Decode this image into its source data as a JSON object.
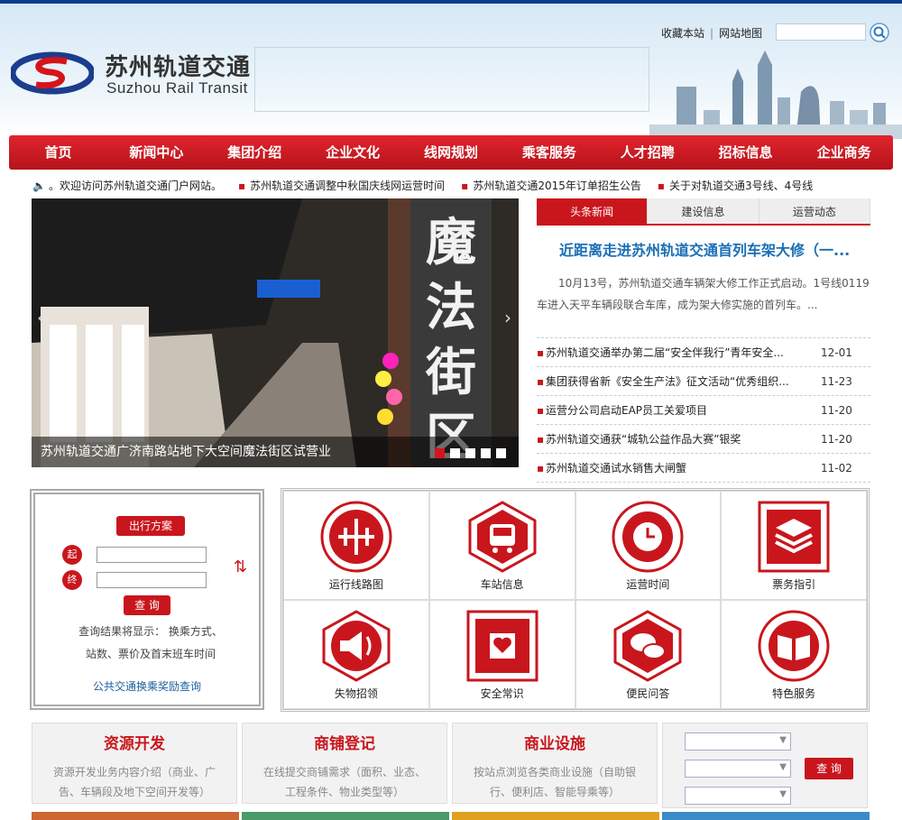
{
  "brand": {
    "cn": "苏州轨道交通",
    "en": "Suzhou Rail Transit",
    "primary": "#c9161d",
    "blue": "#0b3f8a"
  },
  "toplinks": {
    "fav": "收藏本站",
    "sitemap": "网站地图"
  },
  "nav": [
    "首页",
    "新闻中心",
    "集团介绍",
    "企业文化",
    "线网规划",
    "乘客服务",
    "人才招聘",
    "招标信息",
    "企业商务"
  ],
  "ticker": {
    "intro": "。欢迎访问苏州轨道交通门户网站。",
    "items": [
      "苏州轨道交通调整中秋国庆线网运营时间",
      "苏州轨道交通2015年订单招生公告",
      "关于对轨道交通3号线、4号线"
    ]
  },
  "slider": {
    "caption": "苏州轨道交通广济南路站地下大空间魔法街区试营业",
    "sign": "魔法街区",
    "prev": "‹",
    "next": "›"
  },
  "news": {
    "tabs": [
      "头条新闻",
      "建设信息",
      "运营动态"
    ],
    "headline": "近距离走进苏州轨道交通首列车架大修（一...",
    "summary": "10月13号，苏州轨道交通车辆架大修工作正式启动。1号线0119车进入天平车辆段联合车库，成为架大修实施的首列车。...",
    "items": [
      {
        "t": "苏州轨道交通举办第二届“安全伴我行”青年安全...",
        "d": "12-01"
      },
      {
        "t": "集团获得省新《安全生产法》征文活动“优秀组织...",
        "d": "11-23"
      },
      {
        "t": "运营分公司启动EAP员工关爱项目",
        "d": "11-20"
      },
      {
        "t": "苏州轨道交通获“城轨公益作品大赛”银奖",
        "d": "11-20"
      },
      {
        "t": "苏州轨道交通试水销售大闸蟹",
        "d": "11-02"
      }
    ]
  },
  "trip": {
    "title": "出行方案",
    "start": "起",
    "end": "终",
    "query": "查 询",
    "result1": "查询结果将显示： 换乘方式、",
    "result2": "站数、票价及首末班车时间",
    "link": "公共交通换乘奖励查询"
  },
  "services": [
    {
      "label": "运行线路图",
      "icon": "route-map-icon"
    },
    {
      "label": "车站信息",
      "icon": "station-info-icon"
    },
    {
      "label": "运营时间",
      "icon": "clock-icon"
    },
    {
      "label": "票务指引",
      "icon": "ticket-layers-icon"
    },
    {
      "label": "失物招领",
      "icon": "megaphone-icon"
    },
    {
      "label": "安全常识",
      "icon": "heart-shield-icon"
    },
    {
      "label": "便民问答",
      "icon": "chat-bubbles-icon"
    },
    {
      "label": "特色服务",
      "icon": "book-map-icon"
    }
  ],
  "biz": [
    {
      "title": "资源开发",
      "desc": "资源开发业务内容介绍（商业、广告、车辆段及地下空间开发等）"
    },
    {
      "title": "商铺登记",
      "desc": "在线提交商铺需求（面积、业态、工程条件、物业类型等）"
    },
    {
      "title": "商业设施",
      "desc": "按站点浏览各类商业设施（自助银行、便利店、智能导乘等）"
    }
  ],
  "bizquery": {
    "btn": "查 询"
  }
}
